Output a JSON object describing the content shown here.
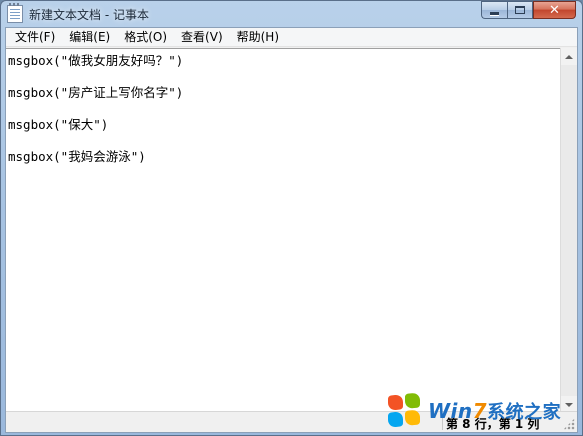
{
  "window": {
    "title": "新建文本文档 - 记事本",
    "icon": "notepad-icon",
    "controls": {
      "minimize": "minimize-icon",
      "maximize": "maximize-icon",
      "close_label": "✕"
    }
  },
  "menu": {
    "items": [
      {
        "label": "文件(F)"
      },
      {
        "label": "编辑(E)"
      },
      {
        "label": "格式(O)"
      },
      {
        "label": "查看(V)"
      },
      {
        "label": "帮助(H)"
      }
    ]
  },
  "editor": {
    "lines": [
      "msgbox(\"做我女朋友好吗？\")",
      "",
      "msgbox(\"房产证上写你名字\")",
      "",
      "msgbox(\"保大\")",
      "",
      "msgbox(\"我妈会游泳\")"
    ]
  },
  "statusbar": {
    "position": "第 8 行，第 1 列"
  },
  "watermark": {
    "text_w": "Win",
    "text_7": "7",
    "text_cn": "系统之家",
    "logo": "windows-logo-icon"
  }
}
